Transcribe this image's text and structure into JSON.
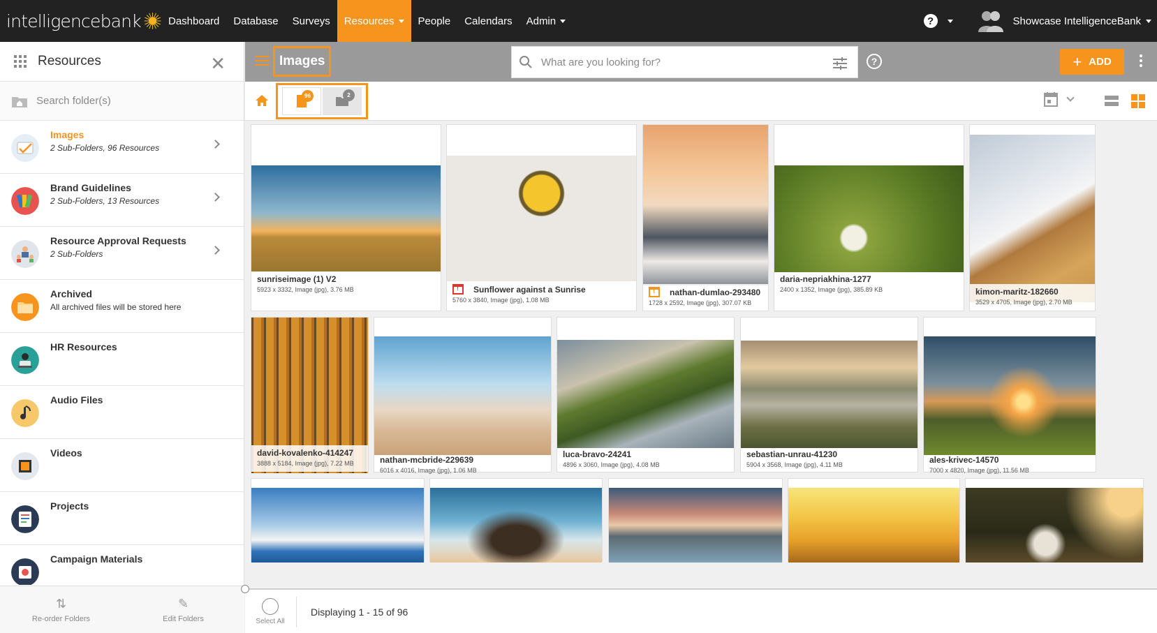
{
  "app": {
    "logo_text": "intelligencebank",
    "nav": [
      "Dashboard",
      "Database",
      "Surveys",
      "Resources",
      "People",
      "Calendars",
      "Admin"
    ],
    "active_nav": "Resources",
    "help_label": "?",
    "user_name": "Showcase IntelligenceBank",
    "accent_color": "#f7941d"
  },
  "sidebar": {
    "title": "Resources",
    "search_placeholder": "Search folder(s)",
    "folders": [
      {
        "name": "Images",
        "sub": "2 Sub-Folders, 96 Resources",
        "icon": "images-folder-icon",
        "active": true
      },
      {
        "name": "Brand Guidelines",
        "sub": "2 Sub-Folders, 13 Resources",
        "icon": "brand-guidelines-icon"
      },
      {
        "name": "Resource Approval Requests",
        "sub": "2 Sub-Folders",
        "icon": "approval-requests-icon"
      },
      {
        "name": "Archived",
        "sub": "All archived files will be stored here",
        "icon": "archive-folder-icon"
      },
      {
        "name": "HR Resources",
        "sub": "",
        "icon": "hr-resources-icon"
      },
      {
        "name": "Audio Files",
        "sub": "",
        "icon": "audio-files-icon"
      },
      {
        "name": "Videos",
        "sub": "",
        "icon": "videos-icon"
      },
      {
        "name": "Projects",
        "sub": "",
        "icon": "projects-icon"
      },
      {
        "name": "Campaign Materials",
        "sub": "",
        "icon": "campaign-materials-icon"
      }
    ],
    "footer": {
      "reorder": "Re-order Folders",
      "edit": "Edit Folders"
    }
  },
  "main": {
    "folder_title": "Images",
    "search_placeholder": "What are you looking for?",
    "add_label": "ADD",
    "files_count": "96",
    "folders_count": "2",
    "displaying": "Displaying 1 - 15 of 96",
    "select_all": "Select All"
  },
  "resources": [
    {
      "name": "sunriseimage (1) V2",
      "meta": "5923 x 3332, Image (jpg), 3.76 MB"
    },
    {
      "name": "Sunflower against a Sunrise",
      "meta": "5760 x 3840, Image (jpg), 1.08 MB",
      "status": "red"
    },
    {
      "name": "nathan-dumlao-293480",
      "meta": "1728 x 2592, Image (jpg), 307.07 KB",
      "status": "orange"
    },
    {
      "name": "daria-nepriakhina-1277",
      "meta": "2400 x 1352, Image (jpg), 385.89 KB"
    },
    {
      "name": "kimon-maritz-182660",
      "meta": "3529 x 4705, Image (jpg), 2.70 MB"
    },
    {
      "name": "david-kovalenko-414247",
      "meta": "3888 x 5184, Image (jpg), 7.22 MB"
    },
    {
      "name": "nathan-mcbride-229639",
      "meta": "6016 x 4016, Image (jpg), 1.06 MB"
    },
    {
      "name": "luca-bravo-24241",
      "meta": "4896 x 3060, Image (jpg), 4.08 MB"
    },
    {
      "name": "sebastian-unrau-41230",
      "meta": "5904 x 3568, Image (jpg), 4.11 MB"
    },
    {
      "name": "ales-krivec-14570",
      "meta": "7000 x 4820, Image (jpg), 11.56 MB"
    }
  ]
}
